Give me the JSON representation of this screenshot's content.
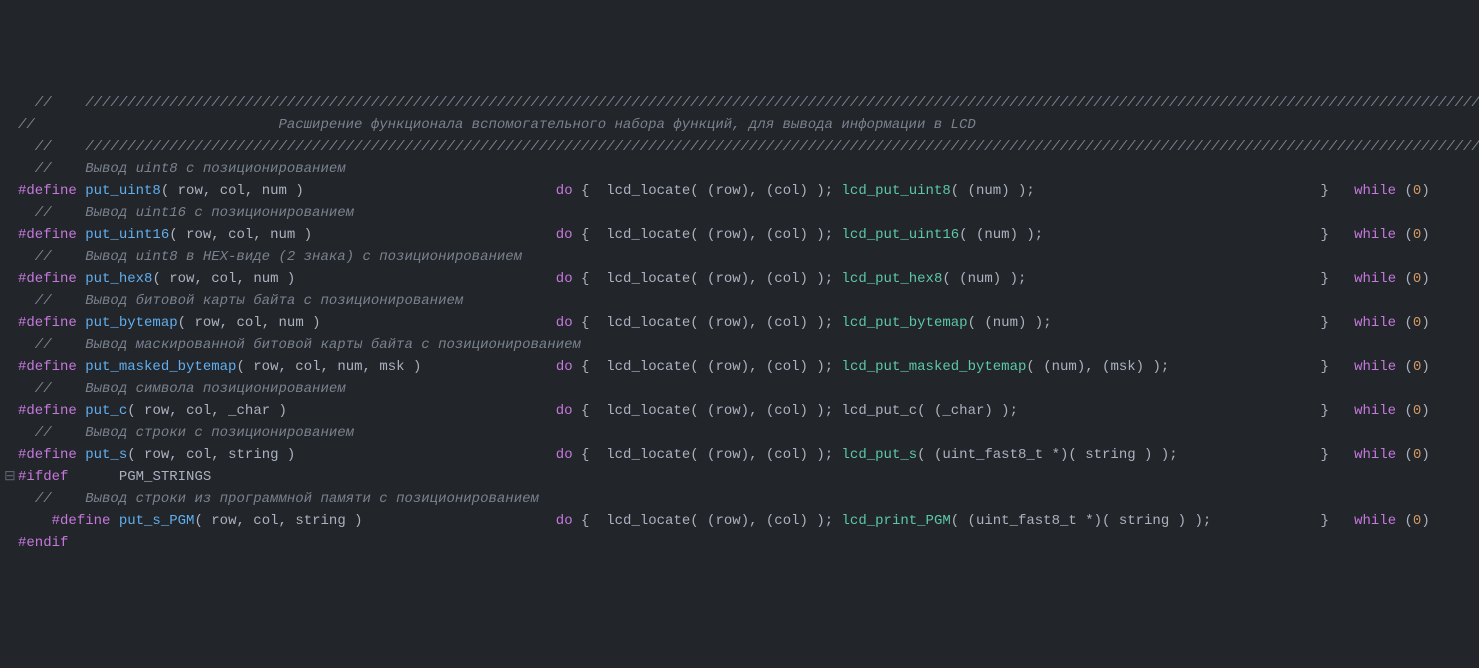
{
  "sep": "  //    ///////////////////////////////////////////////////////////////////////////////////////////////////////////////////////////////////////////////////////////////////////////////////////",
  "banner": "//                             Расширение функционала вспомогательного набора функций, для вывода информации в LCD",
  "ifdef": {
    "kw": "#ifdef",
    "sym": "PGM_STRINGS"
  },
  "endif": "#endif",
  "fold_glyph": "⊟",
  "cm": {
    "u8": "//    Вывод uint8 с позиционированием",
    "u16": "//    Вывод uint16 с позиционированием",
    "h8": "//    Вывод uint8 в HEX-виде (2 знака) с позиционированием",
    "bm": "//    Вывод битовой карты байта с позиционированием",
    "mbm": "//    Вывод маскированной битовой карты байта с позиционированием",
    "pc": "//    Вывод символа позиционированием",
    "ps": "//    Вывод строки с позиционированием",
    "pgm": "//    Вывод строки из программной памяти с позиционированием"
  },
  "def": "#define",
  "locate": "lcd_locate",
  "do": "do",
  "while": "while",
  "zero": "0",
  "row": "row",
  "col": "col",
  "num": "num",
  "msk": "msk",
  "chr": "_char",
  "str": "string",
  "cast": "uint_fast8_t",
  "macros": {
    "u8": {
      "name": "put_uint8",
      "args": "( row, col, num )",
      "body_fn": "lcd_put_uint8",
      "body_args": "( (num) );"
    },
    "u16": {
      "name": "put_uint16",
      "args": "( row, col, num )",
      "body_fn": "lcd_put_uint16",
      "body_args": "( (num) );"
    },
    "h8": {
      "name": "put_hex8",
      "args": "( row, col, num )",
      "body_fn": "lcd_put_hex8",
      "body_args": "( (num) );"
    },
    "bm": {
      "name": "put_bytemap",
      "args": "( row, col, num )",
      "body_fn": "lcd_put_bytemap",
      "body_args": "( (num) );"
    },
    "mbm": {
      "name": "put_masked_bytemap",
      "args": "( row, col, num, msk )",
      "body_fn": "lcd_put_masked_bytemap",
      "body_args": "( (num), (msk) );"
    },
    "pc": {
      "name": "put_c",
      "args": "( row, col, _char )",
      "body_fn": "lcd_put_c",
      "body_args": "( (_char) );"
    },
    "ps": {
      "name": "put_s",
      "args": "( row, col, string )",
      "body_fn": "lcd_put_s",
      "body_args": "( (uint_fast8_t *)( string ) );"
    },
    "pgm": {
      "name": "put_s_PGM",
      "args": "( row, col, string )",
      "body_fn": "lcd_print_PGM",
      "body_args": "( (uint_fast8_t *)( string ) );"
    }
  },
  "col_body": 64,
  "col_endbrace": 155,
  "col_while": 160,
  "indent_pgm": "    "
}
